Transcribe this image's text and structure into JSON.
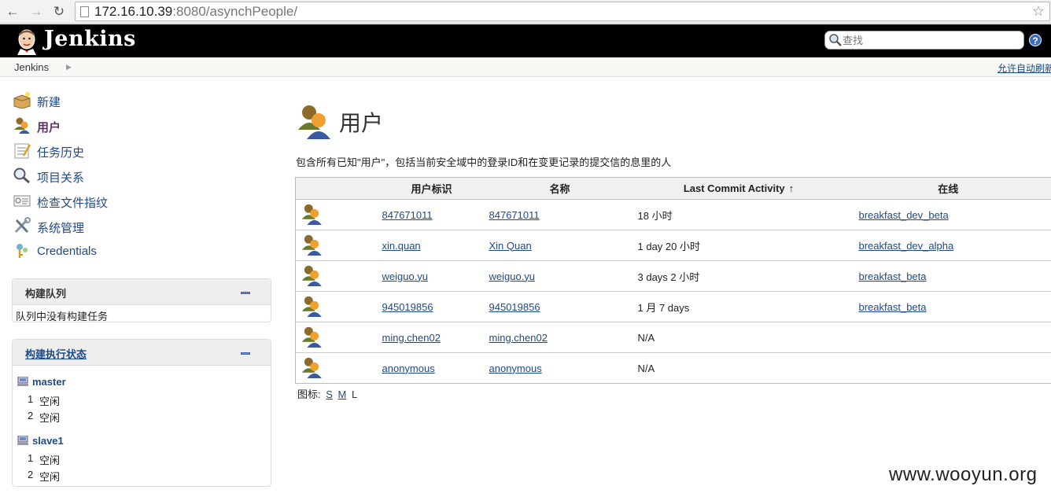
{
  "browser": {
    "url_host": "172.16.10.39",
    "url_rest": ":8080/asynchPeople/"
  },
  "header": {
    "brand": "Jenkins",
    "search_placeholder": "查找",
    "help": "?"
  },
  "breadcrumb": {
    "root": "Jenkins",
    "auto_refresh": "允许自动刷新"
  },
  "sidebar": {
    "tasks": [
      {
        "label": "新建",
        "icon": "new-package-icon"
      },
      {
        "label": "用户",
        "icon": "people-icon",
        "active": true
      },
      {
        "label": "任务历史",
        "icon": "notepad-icon"
      },
      {
        "label": "项目关系",
        "icon": "search-icon"
      },
      {
        "label": "检查文件指纹",
        "icon": "fingerprint-icon"
      },
      {
        "label": "系统管理",
        "icon": "tools-icon"
      },
      {
        "label": "Credentials",
        "icon": "credentials-icon"
      }
    ],
    "build_queue": {
      "title": "构建队列",
      "empty": "队列中没有构建任务"
    },
    "executors": {
      "title": "构建执行状态",
      "nodes": [
        {
          "name": "master",
          "rows": [
            {
              "num": "1",
              "status": "空闲"
            },
            {
              "num": "2",
              "status": "空闲"
            }
          ]
        },
        {
          "name": "slave1",
          "rows": [
            {
              "num": "1",
              "status": "空闲"
            },
            {
              "num": "2",
              "status": "空闲"
            }
          ]
        }
      ]
    }
  },
  "main": {
    "title": "用户",
    "description": "包含所有已知\"用户\"，包括当前安全域中的登录ID和在变更记录的提交信的息里的人",
    "table": {
      "headers": [
        "用户标识",
        "名称",
        "Last Commit Activity",
        "在线"
      ],
      "sort_indicator": "↑",
      "rows": [
        {
          "id": "847671011",
          "name": "847671011",
          "activity": "18 小时",
          "on": "breakfast_dev_beta"
        },
        {
          "id": "xin.quan",
          "name": "Xin Quan",
          "activity": "1 day 20 小时",
          "on": "breakfast_dev_alpha"
        },
        {
          "id": "weiguo.yu",
          "name": "weiguo.yu",
          "activity": "3 days 2 小时",
          "on": "breakfast_beta"
        },
        {
          "id": "945019856",
          "name": "945019856",
          "activity": "1 月 7 days",
          "on": "breakfast_beta"
        },
        {
          "id": "ming.chen02",
          "name": "ming.chen02",
          "activity": "N/A",
          "on": ""
        },
        {
          "id": "anonymous",
          "name": "anonymous",
          "activity": "N/A",
          "on": ""
        }
      ]
    },
    "icon_sizes": {
      "label": "图标:",
      "small": "S",
      "medium": "M",
      "large": "L"
    }
  },
  "watermark": "www.wooyun.org"
}
